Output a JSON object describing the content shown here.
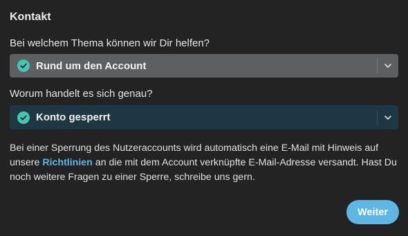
{
  "header": {
    "title": "Kontakt"
  },
  "topic": {
    "label": "Bei welchem Thema können wir Dir helfen?",
    "selected": "Rund um den Account",
    "icon": "check-circle-icon",
    "background": "#5d5f61"
  },
  "detail": {
    "label": "Worum handelt es sich genau?",
    "selected": "Konto gesperrt",
    "icon": "check-circle-icon",
    "background": "#1f3643"
  },
  "info": {
    "text_before_link": "Bei einer Sperrung des Nutzeraccounts wird automatisch eine E-Mail mit Hinweis auf unsere ",
    "link_text": "Richtlinien",
    "text_after_link": " an die mit dem Account verknüpfte E-Mail-Adresse versandt. Hast Du noch weitere Fragen zu einer Sperre, schreibe uns gern."
  },
  "actions": {
    "next_label": "Weiter"
  },
  "colors": {
    "background": "#232323",
    "accent": "#5cb7e4",
    "check": "#45c6b5",
    "link": "#5eb7e6"
  }
}
